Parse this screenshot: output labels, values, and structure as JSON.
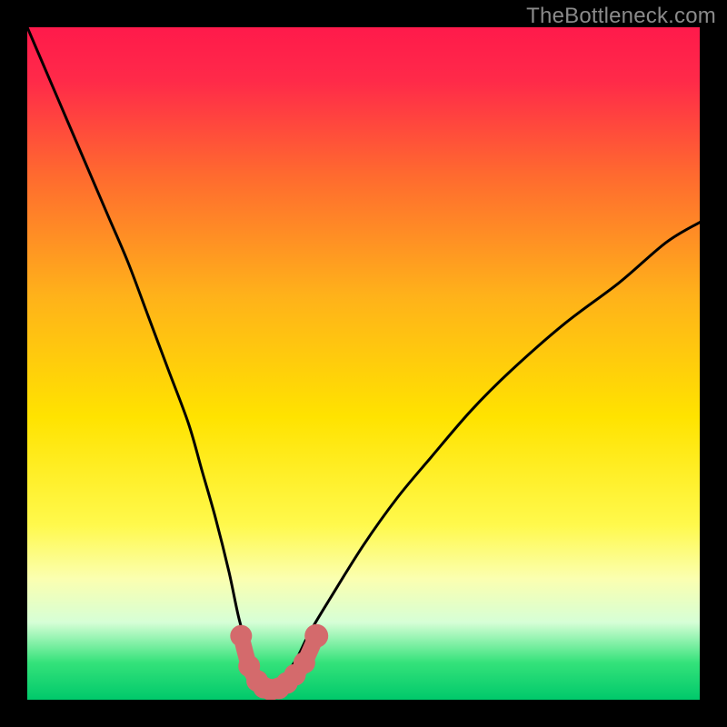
{
  "watermark": "TheBottleneck.com",
  "chart_data": {
    "type": "line",
    "title": "",
    "xlabel": "",
    "ylabel": "",
    "xlim": [
      0,
      100
    ],
    "ylim": [
      0,
      100
    ],
    "grid": false,
    "legend": null,
    "background_gradient_stops": [
      {
        "pos": 0.0,
        "color": "#ff1a4b"
      },
      {
        "pos": 0.08,
        "color": "#ff2a49"
      },
      {
        "pos": 0.22,
        "color": "#ff6a2f"
      },
      {
        "pos": 0.4,
        "color": "#ffb21a"
      },
      {
        "pos": 0.58,
        "color": "#ffe300"
      },
      {
        "pos": 0.74,
        "color": "#fff94c"
      },
      {
        "pos": 0.82,
        "color": "#fbffb0"
      },
      {
        "pos": 0.885,
        "color": "#d6ffd6"
      },
      {
        "pos": 0.945,
        "color": "#34e27a"
      },
      {
        "pos": 1.0,
        "color": "#00c96b"
      }
    ],
    "series": [
      {
        "name": "bottleneck-curve",
        "color": "#000000",
        "x": [
          0,
          3,
          6,
          9,
          12,
          15,
          18,
          21,
          24,
          26,
          28,
          30,
          31.5,
          33,
          34.5,
          35.5,
          36.2,
          37,
          38,
          40,
          42,
          45,
          50,
          55,
          60,
          66,
          72,
          80,
          88,
          95,
          100
        ],
        "y": [
          100,
          93,
          86,
          79,
          72,
          65,
          57,
          49,
          41,
          34,
          27,
          19,
          12,
          7,
          3.5,
          1.8,
          1.5,
          1.8,
          3.2,
          6,
          10,
          15,
          23,
          30,
          36,
          43,
          49,
          56,
          62,
          68,
          71
        ]
      }
    ],
    "markers": {
      "name": "highlight-band",
      "color": "#d46a6c",
      "x": [
        31.8,
        33.0,
        34.2,
        35.2,
        36.2,
        37.4,
        38.6,
        39.8,
        41.2,
        43.0
      ],
      "y": [
        9.5,
        5.0,
        2.8,
        1.8,
        1.5,
        1.7,
        2.5,
        3.7,
        5.5,
        9.5
      ],
      "size": [
        12,
        12,
        12,
        12,
        12,
        12,
        12,
        12,
        12,
        13
      ]
    }
  }
}
